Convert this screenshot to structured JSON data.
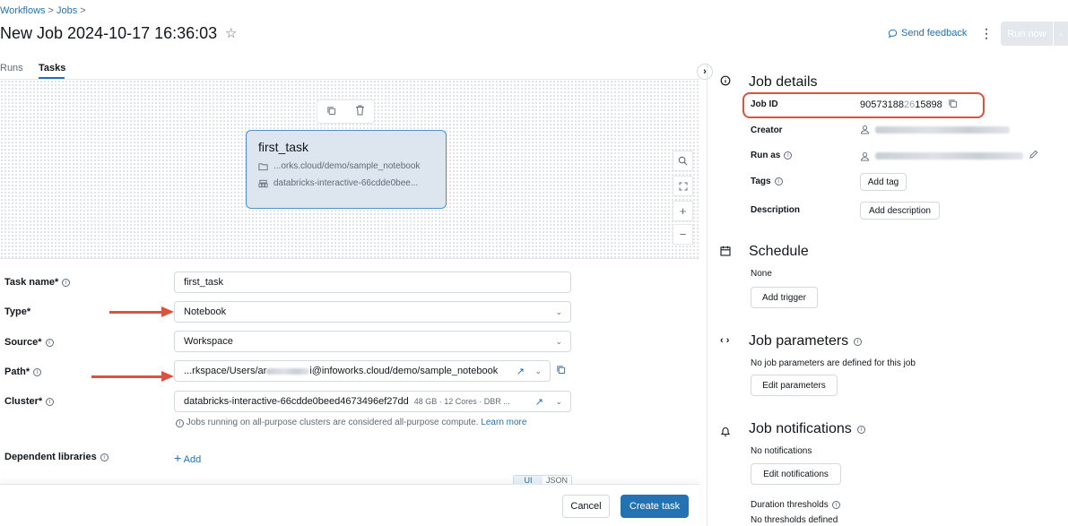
{
  "breadcrumb": {
    "items": [
      "Workflows",
      "Jobs"
    ],
    "separator": ">"
  },
  "header": {
    "title": "New Job 2024-10-17 16:36:03",
    "star_icon": "☆",
    "feedback_label": "Send feedback",
    "kebab_icon": "⋮",
    "run_now_label": "Run now",
    "run_caret_icon": "⌄"
  },
  "tabs": [
    {
      "label": "Runs",
      "active": false
    },
    {
      "label": "Tasks",
      "active": true
    }
  ],
  "canvas": {
    "node": {
      "name": "first_task",
      "path": "...orks.cloud/demo/sample_notebook",
      "cluster": "databricks-interactive-66cdde0bee..."
    },
    "zoom_icons": [
      "search-icon",
      "fit-icon",
      "plus-icon",
      "minus-icon"
    ]
  },
  "form": {
    "task_name": {
      "label": "Task name*",
      "value": "first_task"
    },
    "type": {
      "label": "Type*",
      "value": "Notebook"
    },
    "source": {
      "label": "Source*",
      "value": "Workspace"
    },
    "path": {
      "label": "Path*",
      "value_prefix": "...rkspace/Users/ar",
      "value_suffix": "i@infoworks.cloud/demo/sample_notebook"
    },
    "cluster": {
      "label": "Cluster*",
      "value": "databricks-interactive-66cdde0beed4673496ef27dd",
      "meta": "48 GB · 12 Cores · DBR ..."
    },
    "helper": {
      "text": "Jobs running on all-purpose clusters are considered all-purpose compute.",
      "link": "Learn more"
    },
    "dependent_libraries": {
      "label": "Dependent libraries",
      "add_label": "Add"
    },
    "toggle": {
      "ui": "UI",
      "json": "JSON"
    }
  },
  "footer": {
    "cancel_label": "Cancel",
    "create_label": "Create task"
  },
  "details": {
    "title": "Job details",
    "job_id_label": "Job ID",
    "job_id_prefix": "90573188",
    "job_id_masked": "26",
    "job_id_suffix": "15898",
    "creator_label": "Creator",
    "run_as_label": "Run as",
    "tags_label": "Tags",
    "add_tag_label": "Add tag",
    "description_label": "Description",
    "add_description_label": "Add description"
  },
  "schedule": {
    "title": "Schedule",
    "value": "None",
    "button": "Add trigger"
  },
  "parameters": {
    "title": "Job parameters",
    "text": "No job parameters are defined for this job",
    "button": "Edit parameters"
  },
  "notifications": {
    "title": "Job notifications",
    "text": "No notifications",
    "button": "Edit notifications",
    "duration_label": "Duration thresholds",
    "duration_text": "No thresholds defined"
  },
  "colors": {
    "accent": "#2272b4",
    "annotation": "#d9533f",
    "node_fill": "#dde6ef"
  }
}
